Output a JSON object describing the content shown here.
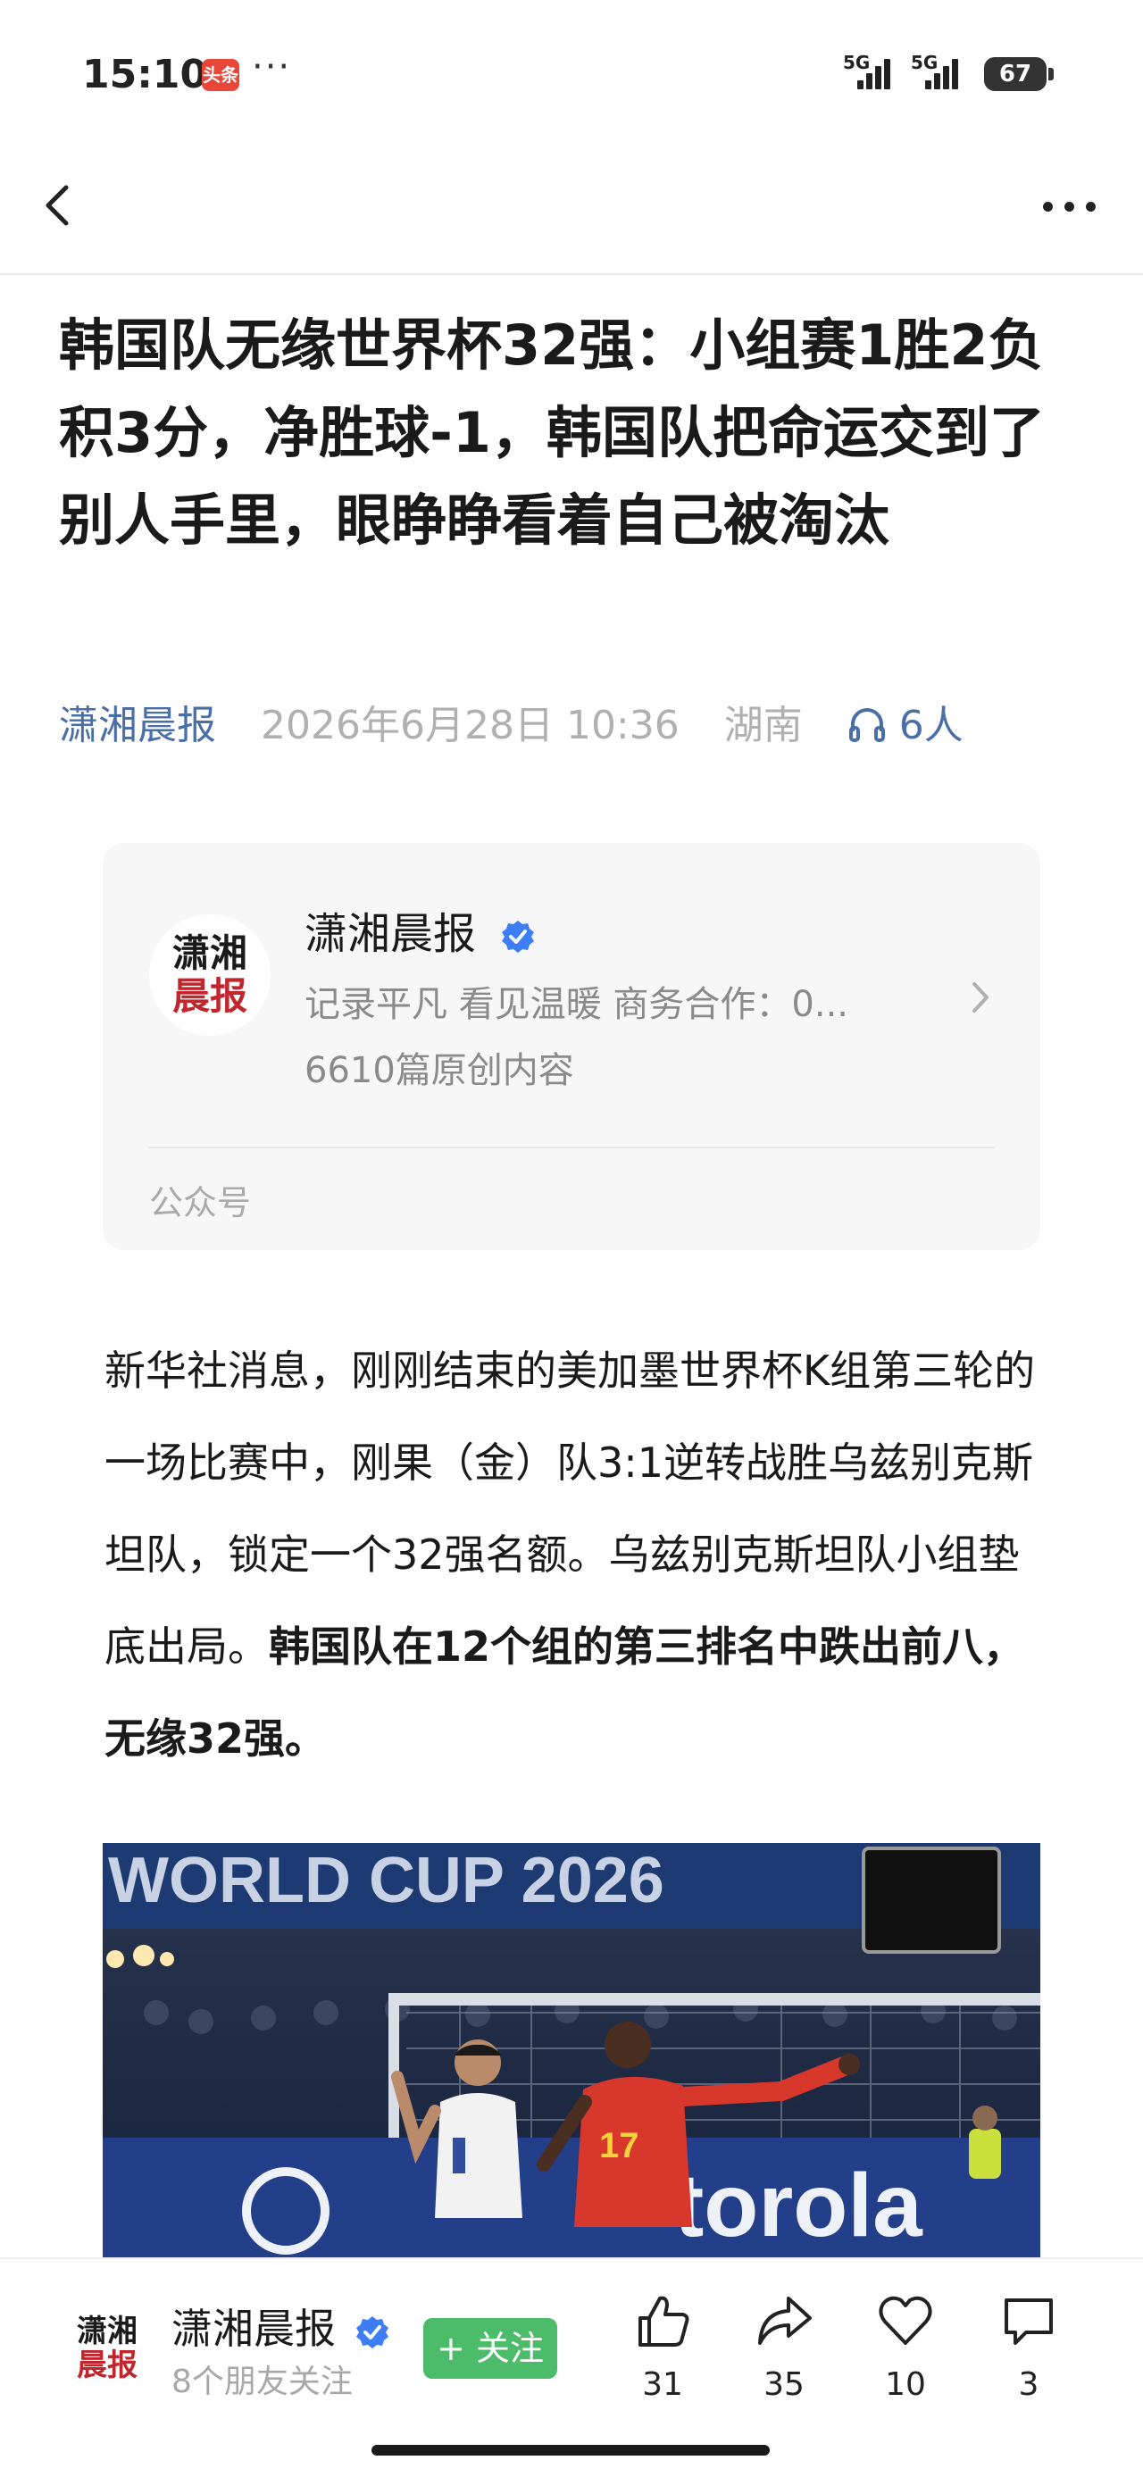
{
  "status_bar": {
    "time": "15:10",
    "app_badge": "头条",
    "more": "···",
    "signal_1": "5G",
    "signal_2": "5G",
    "battery": "67"
  },
  "article": {
    "title": "韩国队无缘世界杯32强：小组赛1胜2负积3分，净胜球-1，韩国队把命运交到了别人手里，眼睁睁看着自己被淘汰",
    "source": "潇湘晨报",
    "datetime": "2026年6月28日 10:36",
    "location": "湖南",
    "listeners": "6人",
    "body_normal": "新华社消息，刚刚结束的美加墨世界杯K组第三轮的一场比赛中，刚果（金）队3:1逆转战胜乌兹别克斯坦队，锁定一个32强名额。乌兹别克斯坦队小组垫底出局。",
    "body_bold": "韩国队在12个组的第三排名中跌出前八，无缘32强。",
    "photo_banner": "WORLD CUP 2026",
    "photo_ad": "torola",
    "jersey_number": "17"
  },
  "profile_card": {
    "logo_line1": "潇湘",
    "logo_line2": "晨报",
    "name": "潇湘晨报",
    "description": "记录平凡 看见温暖 商务合作：0...",
    "original_count": "6610篇原创内容",
    "account_type": "公众号"
  },
  "bottom_bar": {
    "name": "潇湘晨报",
    "friends_following": "8个朋友关注",
    "follow_label": "+ 关注",
    "like_count": "31",
    "share_count": "35",
    "favorite_count": "10",
    "comment_count": "3"
  },
  "colors": {
    "accent_blue": "#4a6ea8",
    "follow_green": "#4cbc6a",
    "logo_red": "#c0262d",
    "verified_blue": "#3d7df5"
  }
}
